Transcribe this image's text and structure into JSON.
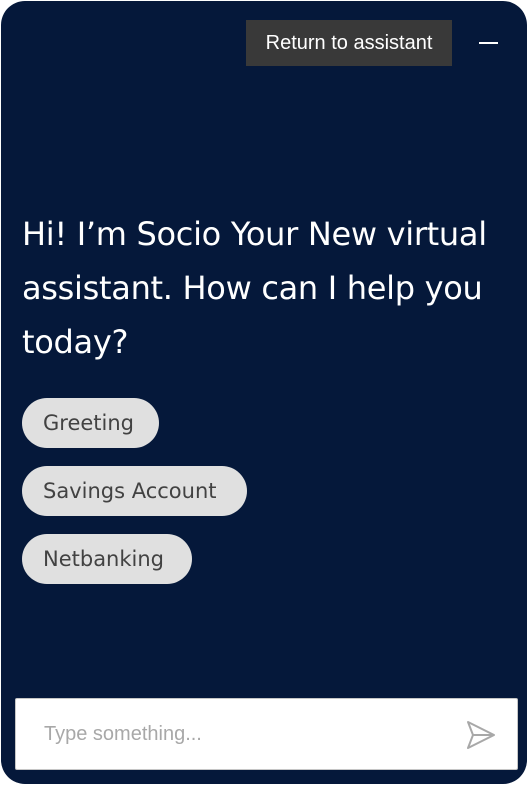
{
  "header": {
    "return_label": "Return to assistant",
    "minimize_icon": "minimize-icon"
  },
  "conversation": {
    "greeting": "Hi! I’m Socio Your New virtual assistant. How can I help you today?",
    "quick_replies": [
      {
        "label": "Greeting"
      },
      {
        "label": "Savings Account"
      },
      {
        "label": "Netbanking"
      }
    ]
  },
  "composer": {
    "value": "",
    "placeholder": "Type something...",
    "send_icon": "send-icon"
  },
  "colors": {
    "background": "#05183a",
    "return_button": "#393939",
    "chip_background": "#e0e0e0",
    "chip_text": "#424242",
    "placeholder": "#a8a8a8"
  }
}
